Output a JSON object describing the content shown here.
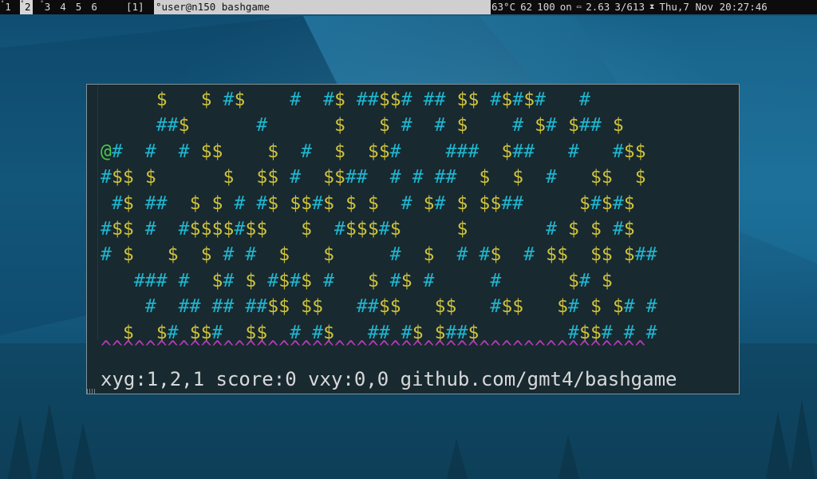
{
  "topbar": {
    "workspaces": [
      {
        "sup": "°",
        "num": "1",
        "active": false
      },
      {
        "sup": "°",
        "num": "2",
        "active": true
      },
      {
        "sup": "°",
        "num": "3",
        "active": false
      },
      {
        "sup": "",
        "num": "4",
        "active": false
      },
      {
        "sup": "",
        "num": "5",
        "active": false
      },
      {
        "sup": "",
        "num": "6",
        "active": false
      }
    ],
    "layout": "[1]",
    "window_title": "°user@n150 bashgame",
    "temp": "63°C",
    "cpu": "62",
    "battery": "100",
    "ac": "on",
    "load_icon": "monitor-icon",
    "load": "2.63",
    "mem": "3/613",
    "clock_icon": "hourglass-icon",
    "datetime": "Thu,7 Nov 20:27:46"
  },
  "terminal": {
    "rows": [
      "     $   $ #$    #  #$ ##$$# ## $$ #$#$#   #",
      "     ##$      #      $   $ #  # $    # $# $## $",
      "@#  #  # $$    $  #  $  $$#    ###  $##   #   #$$",
      "#$$ $      $  $$ #  $$##  # # ##  $  $  #   $$  $",
      " #$ ##  $ $ # #$ $$#$ $ $  # $# $ $$##     $#$#$",
      "#$$ #  #$$$$#$$   $  #$$$#$     $       # $ $ #$",
      "# $   $  $ # #  $   $     #  $  # #$  # $$  $$ $##",
      "   ### #  $# $ #$#$ #   $ #$ #     #      $# $",
      "    #  ## ## ##$$ $$   ##$$   $$   #$$   $# $ $# #",
      "  $  $# $$#  $$  # #$   ## #$ $##$        #$$# # #"
    ],
    "floor": "^^^^^^^^^^^^^^^^^^^^^^^^^^^^^^^^^^^^^^^^^^^^^^^^^",
    "status_line": "xyg:1,2,1 score:0 vxy:0,0 github.com/gmt4/bashgame"
  },
  "colors": {
    "hash": "#1fb6cf",
    "dollar": "#cfc23a",
    "player": "#4cc84a",
    "floor": "#b83ab8",
    "terminal_bg": "#182930"
  }
}
